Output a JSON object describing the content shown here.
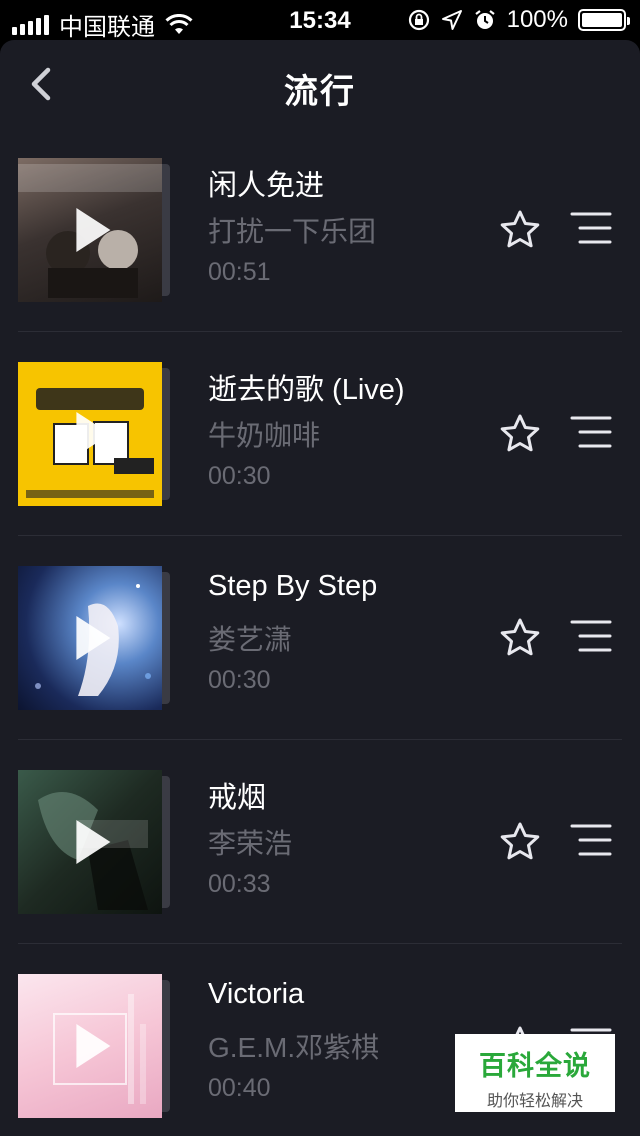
{
  "status_bar": {
    "carrier": "中国联通",
    "time": "15:34",
    "battery": "100%",
    "icons": [
      "signal-icon",
      "wifi-icon",
      "orientation-lock-icon",
      "location-icon",
      "alarm-icon",
      "battery-icon"
    ]
  },
  "nav": {
    "title": "流行",
    "back_icon": "chevron-left-icon"
  },
  "songs": [
    {
      "title": "闲人免进",
      "artist": "打扰一下乐团",
      "duration": "00:51",
      "cover_colors": [
        "#5a4a44",
        "#2a2522",
        "#9a8a80"
      ]
    },
    {
      "title": "逝去的歌 (Live)",
      "artist": "牛奶咖啡",
      "duration": "00:30",
      "cover_colors": [
        "#f7c400",
        "#e0a800",
        "#222222"
      ]
    },
    {
      "title": "Step By Step",
      "artist": "娄艺潇",
      "duration": "00:30",
      "cover_colors": [
        "#1a2a5a",
        "#4a7ab8",
        "#cfd8ff"
      ]
    },
    {
      "title": "戒烟",
      "artist": "李荣浩",
      "duration": "00:33",
      "cover_colors": [
        "#1e2a22",
        "#4a6a5a",
        "#0e1410"
      ]
    },
    {
      "title": "Victoria",
      "artist": "G.E.M.邓紫棋",
      "duration": "00:40",
      "cover_colors": [
        "#f6c6d6",
        "#e9a8c2",
        "#fbe6ee"
      ]
    }
  ],
  "actions": {
    "favorite_icon": "star-outline-icon",
    "menu_icon": "list-menu-icon"
  },
  "watermark": {
    "main": "百科全说",
    "sub": "助你轻松解决"
  }
}
